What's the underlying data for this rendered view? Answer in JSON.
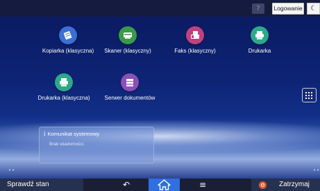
{
  "topbar": {
    "help_label": "?",
    "login_label": "Logowanie",
    "moon_icon": "☾"
  },
  "apps": [
    {
      "label": "Kopiarka (klasyczna)",
      "icon": "copier-icon",
      "color": "#3b6fd6"
    },
    {
      "label": "Skaner (klasyczny)",
      "icon": "scanner-icon",
      "color": "#3a9a4a"
    },
    {
      "label": "Faks (klasyczny)",
      "icon": "fax-icon",
      "color": "#c2407f"
    },
    {
      "label": "Drukarka",
      "icon": "printer-icon",
      "color": "#2ea88c"
    },
    {
      "label": "Drukarka (klasyczna)",
      "icon": "printer-icon",
      "color": "#2ea88c"
    },
    {
      "label": "Serwer dokumentów",
      "icon": "document-server-icon",
      "color": "#8a4fb8"
    }
  ],
  "message": {
    "title": "Komunikat systemowy",
    "info_icon": "i",
    "body": "Brak wiadomości."
  },
  "page_dots": {
    "left": "••",
    "right": "••"
  },
  "bottombar": {
    "status_label": "Sprawdź stan",
    "back_icon": "↶",
    "menu_icon": "≡",
    "stop_label": "Zatrzymaj"
  },
  "colors": {
    "home_active": "#2f6fe0",
    "stop": "#e35a2a"
  }
}
